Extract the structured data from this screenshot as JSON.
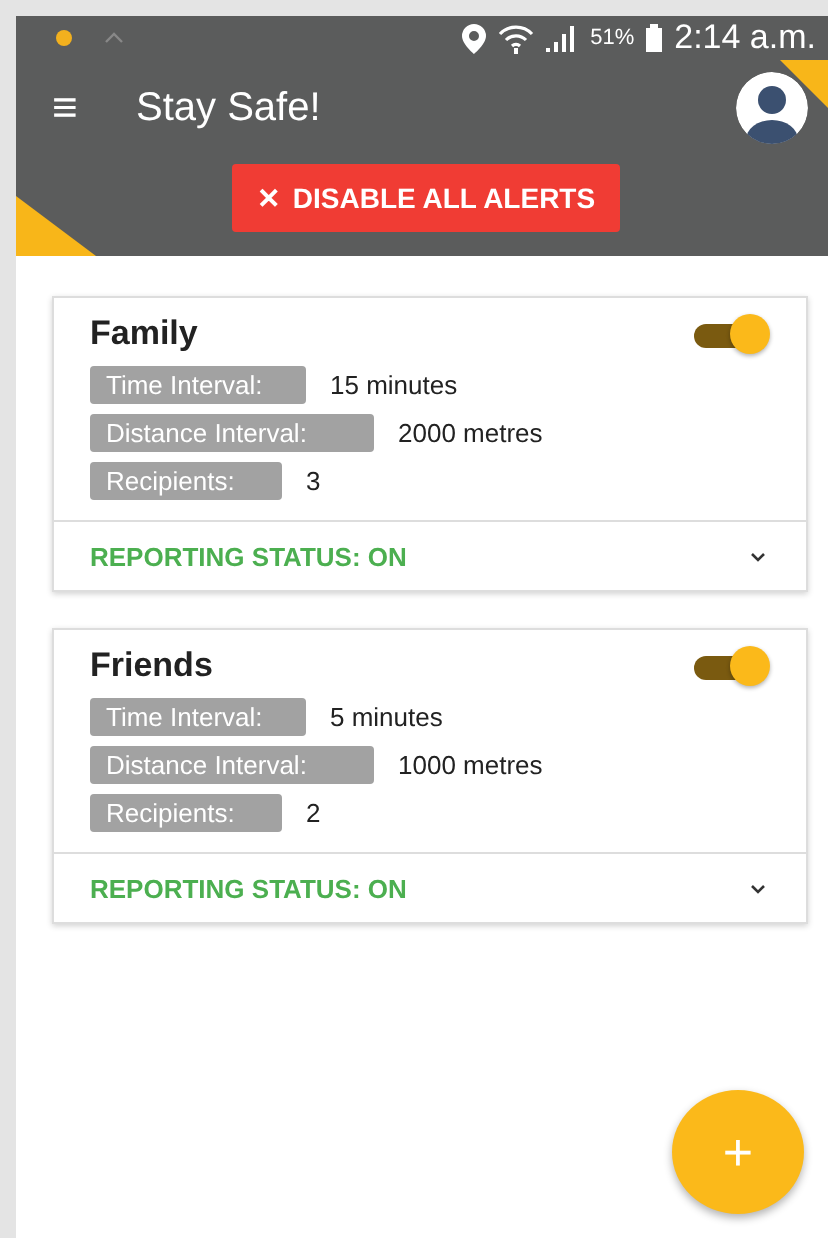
{
  "status_bar": {
    "battery": "51%",
    "time": "2:14 a.m."
  },
  "app_bar": {
    "menu_glyph": "≡",
    "title": "Stay Safe!"
  },
  "disable_button": {
    "glyph": "✕",
    "label": "DISABLE ALL ALERTS"
  },
  "groups": [
    {
      "name": "Family",
      "on": true,
      "fields": [
        {
          "label": "Time Interval:",
          "value": "15 minutes"
        },
        {
          "label": "Distance Interval:",
          "value": "2000 metres"
        },
        {
          "label": "Recipients:",
          "value": "3"
        }
      ],
      "status": "REPORTING STATUS: ON"
    },
    {
      "name": "Friends",
      "on": true,
      "fields": [
        {
          "label": "Time Interval:",
          "value": "5 minutes"
        },
        {
          "label": "Distance Interval:",
          "value": "1000 metres"
        },
        {
          "label": "Recipients:",
          "value": "2"
        }
      ],
      "status": "REPORTING STATUS: ON"
    }
  ],
  "fab": {
    "glyph": "+"
  }
}
